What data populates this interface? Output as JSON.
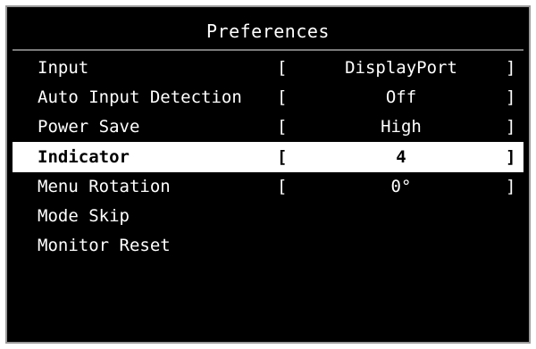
{
  "title": "Preferences",
  "items": [
    {
      "label": "Input",
      "open": "[",
      "value": "DisplayPort",
      "close": "]"
    },
    {
      "label": "Auto Input Detection",
      "open": "[",
      "value": "Off",
      "close": "]"
    },
    {
      "label": "Power Save",
      "open": "[",
      "value": "High",
      "close": "]"
    },
    {
      "label": "Indicator",
      "open": "[",
      "value": "4",
      "close": "]",
      "selected": true
    },
    {
      "label": "Menu Rotation",
      "open": "[",
      "value": "0°",
      "close": "]"
    },
    {
      "label": "Mode Skip"
    },
    {
      "label": "Monitor Reset"
    }
  ],
  "colors": {
    "background": "#000000",
    "text": "#ffffff",
    "highlight": "#ffffff",
    "highlight_text": "#000000"
  }
}
